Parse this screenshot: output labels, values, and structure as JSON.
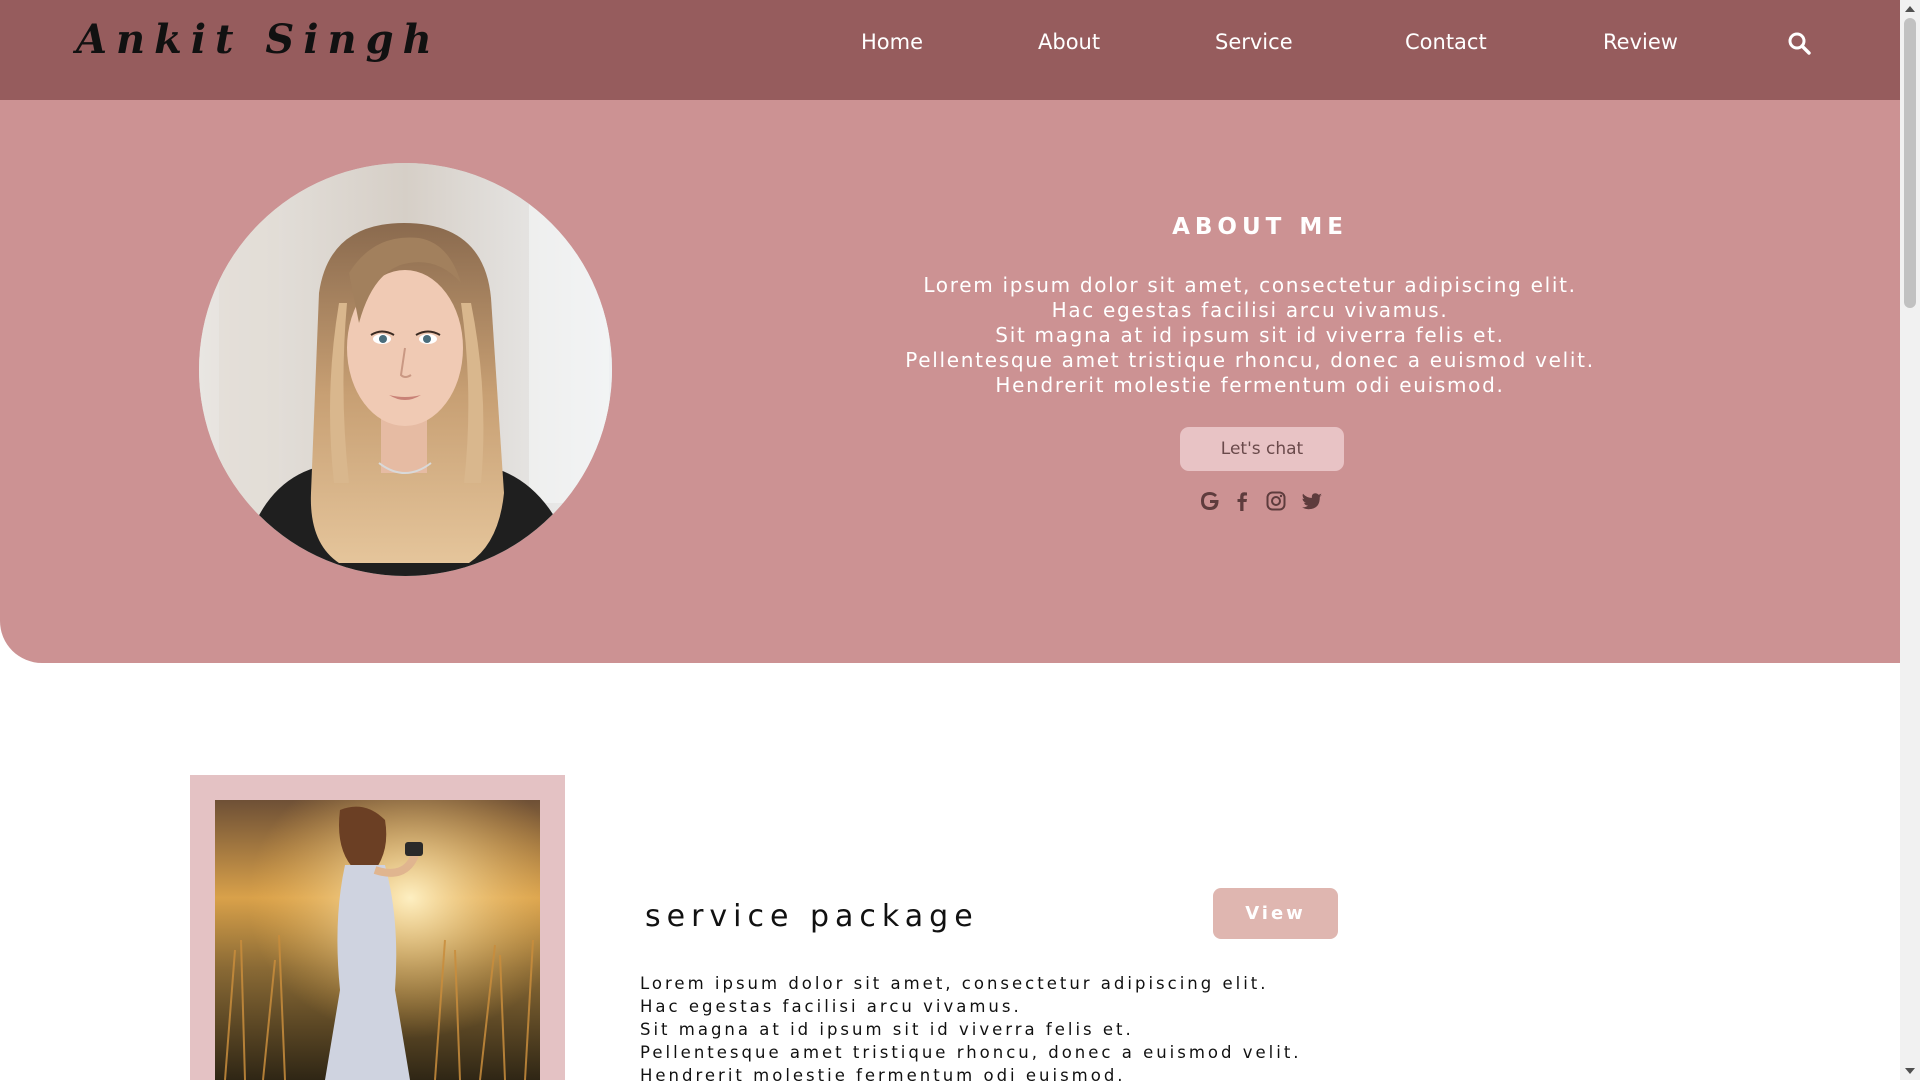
{
  "navbar": {
    "logo": "Ankit Singh",
    "items": [
      {
        "label": "Home"
      },
      {
        "label": "About"
      },
      {
        "label": "Service"
      },
      {
        "label": "Contact"
      },
      {
        "label": "Review"
      }
    ],
    "search_icon": "search-icon",
    "background": "#965c5d"
  },
  "about": {
    "title": "ABOUT ME",
    "lines": [
      "Lorem ipsum dolor sit amet, consectetur adipiscing elit.",
      "Hac egestas facilisi arcu vivamus.",
      "Sit magna at id ipsum sit id viverra felis et.",
      "Pellentesque amet tristique rhoncu, donec a euismod velit.",
      "Hendrerit molestie fermentum odi euismod."
    ],
    "chat_button": "Let's chat",
    "socials": [
      "google-icon",
      "facebook-icon",
      "instagram-icon",
      "twitter-icon"
    ],
    "background": "#cc9293"
  },
  "service": {
    "title": "service package",
    "view_button": "View",
    "lines": [
      "Lorem ipsum dolor sit amet, consectetur adipiscing elit.",
      "Hac egestas facilisi arcu vivamus.",
      "Sit magna at id ipsum sit id viverra felis et.",
      "Pellentesque amet tristique rhoncu, donec a euismod velit.",
      "Hendrerit molestie fermentum odi euismod."
    ]
  }
}
